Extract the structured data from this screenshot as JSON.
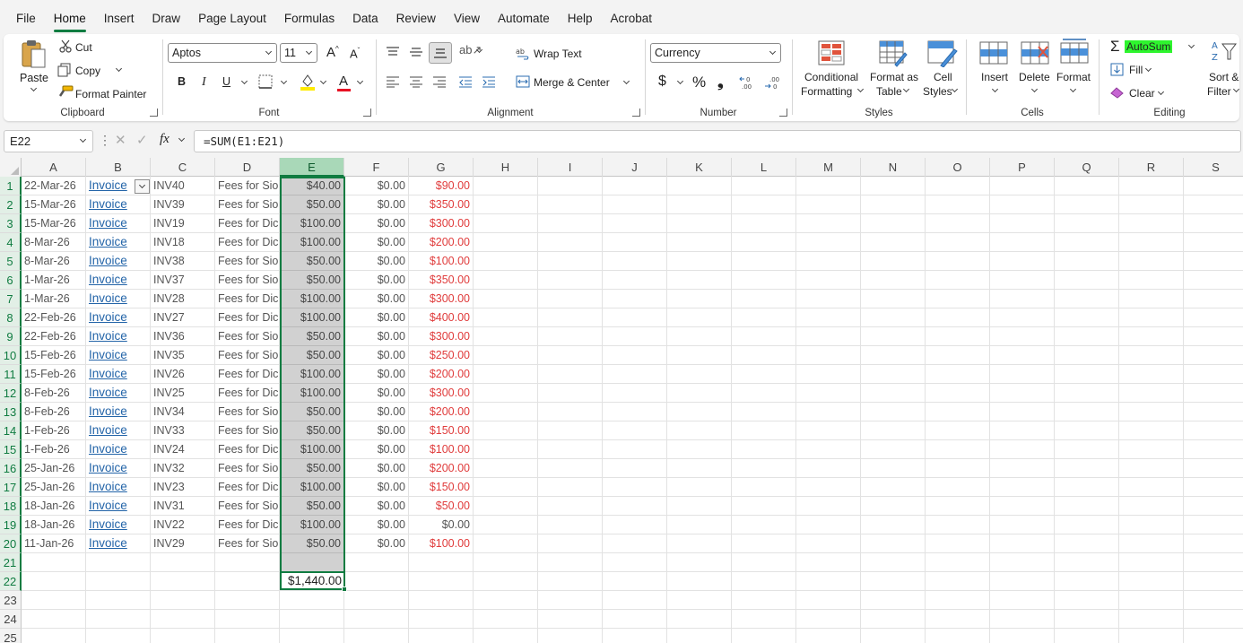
{
  "menu": [
    "File",
    "Home",
    "Insert",
    "Draw",
    "Page Layout",
    "Formulas",
    "Data",
    "Review",
    "View",
    "Automate",
    "Help",
    "Acrobat"
  ],
  "menu_active": "Home",
  "ribbon": {
    "clipboard": {
      "label": "Clipboard",
      "paste": "Paste",
      "cut": "Cut",
      "copy": "Copy",
      "format_painter": "Format Painter"
    },
    "font": {
      "label": "Font",
      "font_name": "Aptos",
      "font_size": "11",
      "bold": "B",
      "italic": "I",
      "underline": "U"
    },
    "alignment": {
      "label": "Alignment",
      "wrap_text": "Wrap Text",
      "merge_center": "Merge & Center"
    },
    "number": {
      "label": "Number",
      "format": "Currency",
      "currency_symbol": "$",
      "percent": "%",
      "comma": "❟"
    },
    "styles": {
      "label": "Styles",
      "conditional_1": "Conditional",
      "conditional_2": "Formatting",
      "format_as_1": "Format as",
      "format_as_2": "Table",
      "cell_styles_1": "Cell",
      "cell_styles_2": "Styles"
    },
    "cells": {
      "label": "Cells",
      "insert": "Insert",
      "delete": "Delete",
      "format": "Format"
    },
    "editing": {
      "label": "Editing",
      "autosum": "AutoSum",
      "fill": "Fill",
      "clear": "Clear",
      "sort_1": "Sort &",
      "sort_2": "Filter"
    }
  },
  "formula_bar": {
    "name_box": "E22",
    "fx": "fx",
    "formula": "=SUM(E1:E21)"
  },
  "columns": [
    "A",
    "B",
    "C",
    "D",
    "E",
    "F",
    "G",
    "H",
    "I",
    "J",
    "K",
    "L",
    "M",
    "N",
    "O",
    "P",
    "Q",
    "R",
    "S"
  ],
  "rows": [
    "1",
    "2",
    "3",
    "4",
    "5",
    "6",
    "7",
    "8",
    "9",
    "10",
    "11",
    "12",
    "13",
    "14",
    "15",
    "16",
    "17",
    "18",
    "19",
    "20",
    "21",
    "22",
    "23",
    "24",
    "25"
  ],
  "data_rows": [
    {
      "a": "22-Mar-26",
      "b": "Invoice",
      "c": "INV40",
      "d": "Fees for Sio",
      "e": "$40.00",
      "f": "$0.00",
      "g": "$90.00",
      "g_red": true
    },
    {
      "a": "15-Mar-26",
      "b": "Invoice",
      "c": "INV39",
      "d": "Fees for Sio",
      "e": "$50.00",
      "f": "$0.00",
      "g": "$350.00",
      "g_red": true
    },
    {
      "a": "15-Mar-26",
      "b": "Invoice",
      "c": "INV19",
      "d": "Fees for Dic",
      "e": "$100.00",
      "f": "$0.00",
      "g": "$300.00",
      "g_red": true
    },
    {
      "a": "8-Mar-26",
      "b": "Invoice",
      "c": "INV18",
      "d": "Fees for Dic",
      "e": "$100.00",
      "f": "$0.00",
      "g": "$200.00",
      "g_red": true
    },
    {
      "a": "8-Mar-26",
      "b": "Invoice",
      "c": "INV38",
      "d": "Fees for Sio",
      "e": "$50.00",
      "f": "$0.00",
      "g": "$100.00",
      "g_red": true
    },
    {
      "a": "1-Mar-26",
      "b": "Invoice",
      "c": "INV37",
      "d": "Fees for Sio",
      "e": "$50.00",
      "f": "$0.00",
      "g": "$350.00",
      "g_red": true
    },
    {
      "a": "1-Mar-26",
      "b": "Invoice",
      "c": "INV28",
      "d": "Fees for Dic",
      "e": "$100.00",
      "f": "$0.00",
      "g": "$300.00",
      "g_red": true
    },
    {
      "a": "22-Feb-26",
      "b": "Invoice",
      "c": "INV27",
      "d": "Fees for Dic",
      "e": "$100.00",
      "f": "$0.00",
      "g": "$400.00",
      "g_red": true
    },
    {
      "a": "22-Feb-26",
      "b": "Invoice",
      "c": "INV36",
      "d": "Fees for Sio",
      "e": "$50.00",
      "f": "$0.00",
      "g": "$300.00",
      "g_red": true
    },
    {
      "a": "15-Feb-26",
      "b": "Invoice",
      "c": "INV35",
      "d": "Fees for Sio",
      "e": "$50.00",
      "f": "$0.00",
      "g": "$250.00",
      "g_red": true
    },
    {
      "a": "15-Feb-26",
      "b": "Invoice",
      "c": "INV26",
      "d": "Fees for Dic",
      "e": "$100.00",
      "f": "$0.00",
      "g": "$200.00",
      "g_red": true
    },
    {
      "a": "8-Feb-26",
      "b": "Invoice",
      "c": "INV25",
      "d": "Fees for Dic",
      "e": "$100.00",
      "f": "$0.00",
      "g": "$300.00",
      "g_red": true
    },
    {
      "a": "8-Feb-26",
      "b": "Invoice",
      "c": "INV34",
      "d": "Fees for Sio",
      "e": "$50.00",
      "f": "$0.00",
      "g": "$200.00",
      "g_red": true
    },
    {
      "a": "1-Feb-26",
      "b": "Invoice",
      "c": "INV33",
      "d": "Fees for Sio",
      "e": "$50.00",
      "f": "$0.00",
      "g": "$150.00",
      "g_red": true
    },
    {
      "a": "1-Feb-26",
      "b": "Invoice",
      "c": "INV24",
      "d": "Fees for Dic",
      "e": "$100.00",
      "f": "$0.00",
      "g": "$100.00",
      "g_red": true
    },
    {
      "a": "25-Jan-26",
      "b": "Invoice",
      "c": "INV32",
      "d": "Fees for Sio",
      "e": "$50.00",
      "f": "$0.00",
      "g": "$200.00",
      "g_red": true
    },
    {
      "a": "25-Jan-26",
      "b": "Invoice",
      "c": "INV23",
      "d": "Fees for Dic",
      "e": "$100.00",
      "f": "$0.00",
      "g": "$150.00",
      "g_red": true
    },
    {
      "a": "18-Jan-26",
      "b": "Invoice",
      "c": "INV31",
      "d": "Fees for Sio",
      "e": "$50.00",
      "f": "$0.00",
      "g": "$50.00",
      "g_red": true
    },
    {
      "a": "18-Jan-26",
      "b": "Invoice",
      "c": "INV22",
      "d": "Fees for Dic",
      "e": "$100.00",
      "f": "$0.00",
      "g": "$0.00",
      "g_red": false
    },
    {
      "a": "11-Jan-26",
      "b": "Invoice",
      "c": "INV29",
      "d": "Fees for Sio",
      "e": "$50.00",
      "f": "$0.00",
      "g": "$100.00",
      "g_red": true
    }
  ],
  "total": {
    "row": "22",
    "value": "$1,440.00"
  },
  "colors": {
    "accent": "#107c41",
    "link": "#2364a8",
    "negative": "#e03c3c",
    "autosum_highlight": "#2ef52e"
  }
}
